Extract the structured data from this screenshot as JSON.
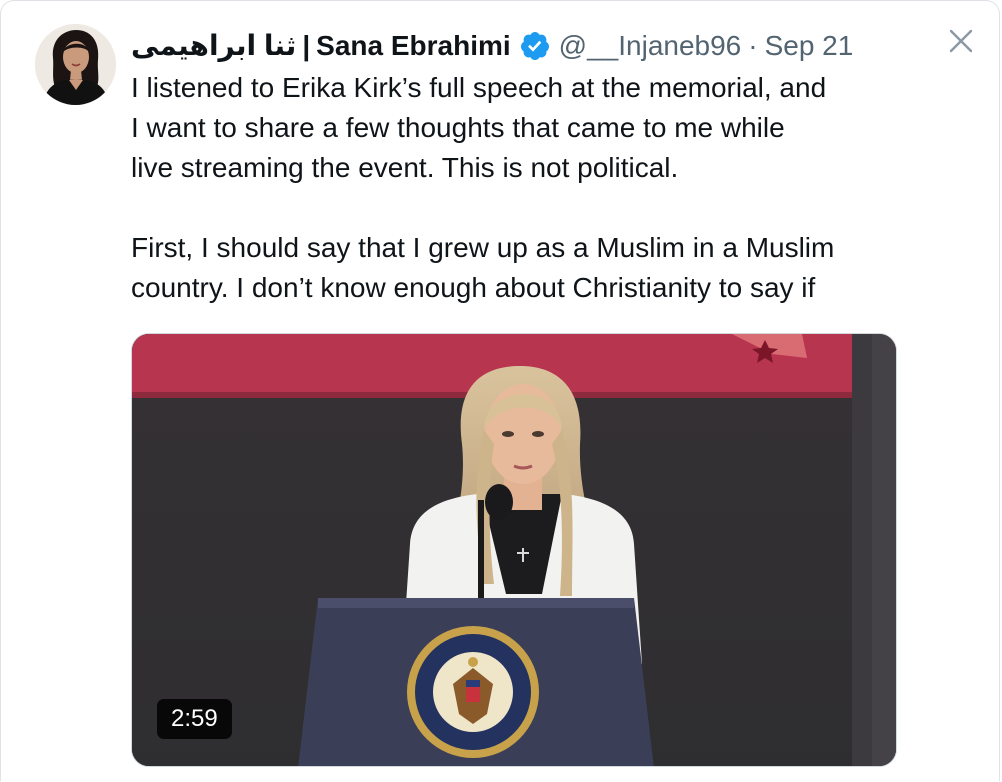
{
  "tweet": {
    "display_name_rtl": "ثنا ابراهیمی",
    "name_separator": "|",
    "display_name": "Sana Ebrahimi",
    "handle": "@__Injaneb96",
    "dot": "·",
    "date": "Sep 21",
    "verified": true,
    "paragraphs": [
      "I listened to Erika Kirk’s full speech at the memorial, and\nI want to share a few thoughts that came to me while\nlive streaming the event. This is not political.",
      "First, I should say that I grew up as a Muslim in a Muslim\ncountry. I don’t know enough about Christianity to say if"
    ],
    "media": {
      "type": "video",
      "duration": "2:59",
      "seal_text": "SEAL OF THE PRESIDENT OF THE UNITED STATES"
    }
  },
  "icons": {
    "verified": "verified-badge-icon",
    "close": "close-icon"
  },
  "colors": {
    "verified_blue": "#1d9bf0",
    "secondary_text": "#536471",
    "primary_text": "#0f1419"
  }
}
